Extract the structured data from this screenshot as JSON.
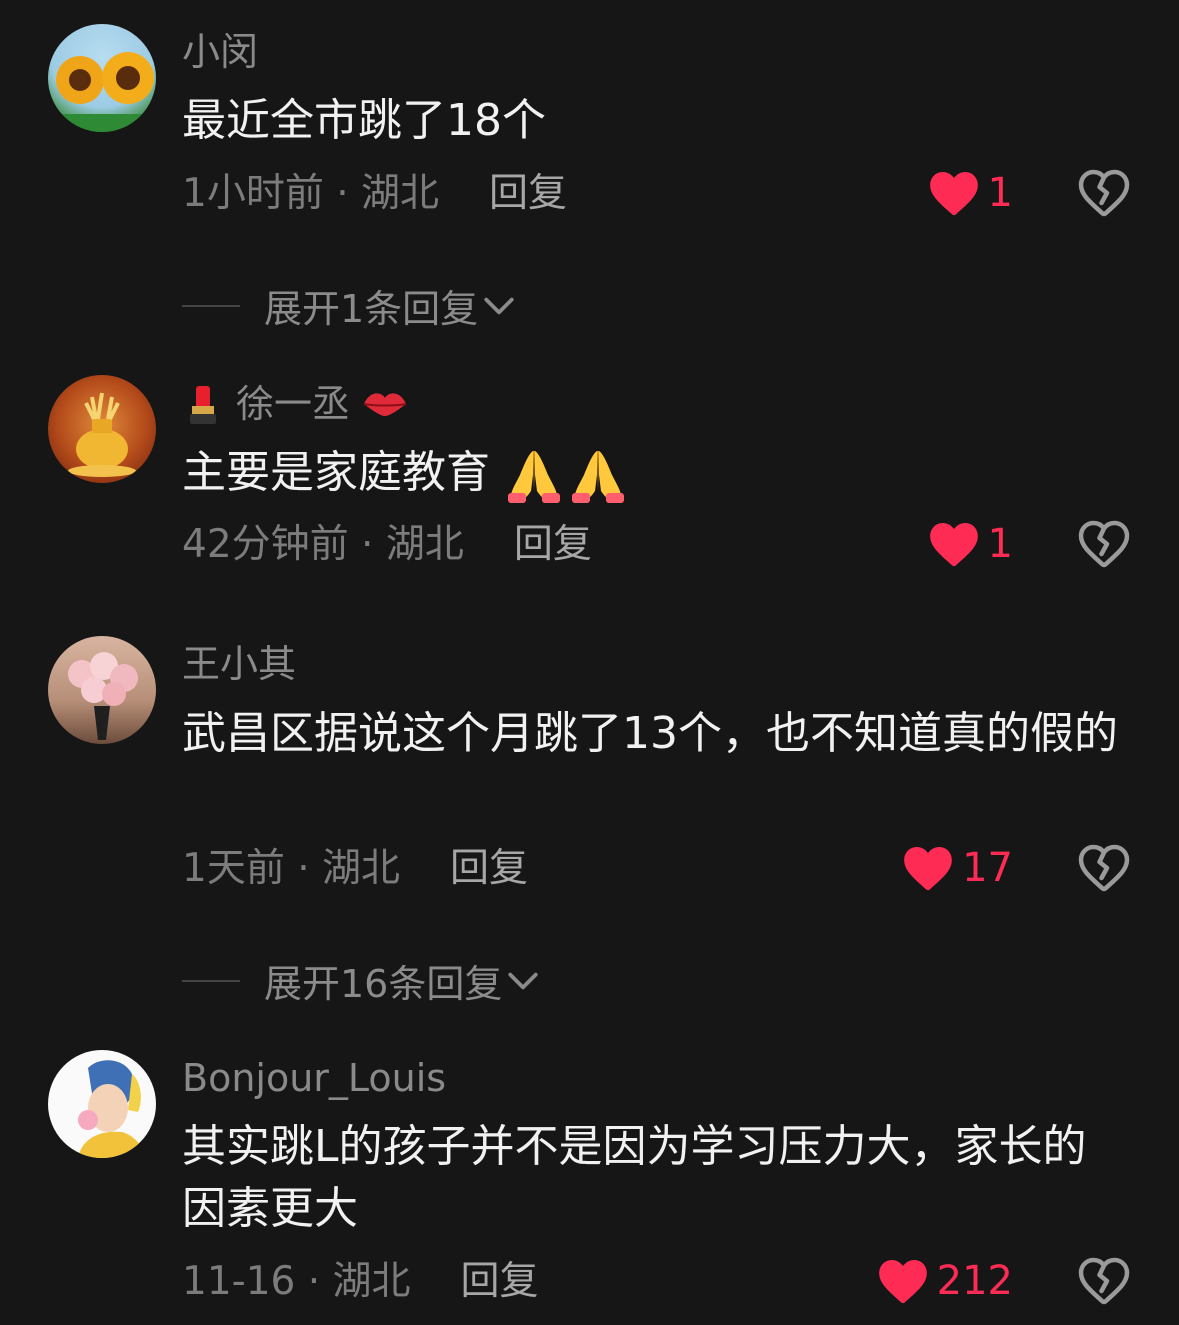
{
  "comments": [
    {
      "username": "小闵",
      "text": "最近全市跳了18个",
      "time_location": "1小时前 · 湖北",
      "reply_label": "回复",
      "likes": "1"
    },
    {
      "username": "徐一丞",
      "text": "主要是家庭教育",
      "time_location": "42分钟前 · 湖北",
      "reply_label": "回复",
      "likes": "1"
    },
    {
      "username": "王小其",
      "text": "武昌区据说这个月跳了13个，也不知道真的假的",
      "time_location": "1天前 · 湖北",
      "reply_label": "回复",
      "likes": "17"
    },
    {
      "username": "Bonjour_Louis",
      "text": "其实跳L的孩子并不是因为学习压力大，家长的因素更大",
      "time_location": "11-16 · 湖北",
      "reply_label": "回复",
      "likes": "212"
    }
  ],
  "expand_replies": [
    {
      "label": "展开1条回复"
    },
    {
      "label": "展开16条回复"
    }
  ],
  "colors": {
    "background": "#161616",
    "like_red": "#fe2c55",
    "text_primary": "#f1f1f1",
    "text_secondary": "#8a8a8a"
  },
  "icons": {
    "like": "heart-icon",
    "dislike": "broken-heart-icon",
    "expand": "chevron-down-icon",
    "username_decor_left": "lipstick-emoji",
    "username_decor_right": "kiss-mark-emoji",
    "text_emoji": "folded-hands-emoji"
  }
}
